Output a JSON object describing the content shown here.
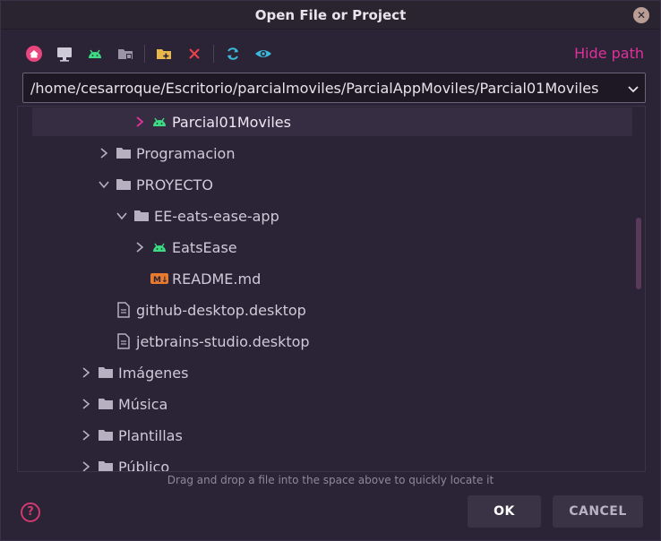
{
  "window": {
    "title": "Open File or Project"
  },
  "toolbar": {
    "icons": [
      "home-icon",
      "desktop-icon",
      "android-icon",
      "project-folder-icon",
      "new-folder-icon",
      "delete-icon",
      "refresh-icon",
      "show-hidden-icon"
    ],
    "hide_path_label": "Hide path"
  },
  "path": {
    "value": "/home/cesarroque/Escritorio/parcialmoviles/ParcialAppMoviles/Parcial01Moviles"
  },
  "tree": {
    "items": [
      {
        "label": "Parcial01Moviles",
        "icon": "android-icon",
        "expander": "collapsed",
        "selected": true
      },
      {
        "label": "Programacion",
        "icon": "folder-icon",
        "expander": "collapsed"
      },
      {
        "label": "PROYECTO",
        "icon": "folder-icon",
        "expander": "expanded"
      },
      {
        "label": "EE-eats-ease-app",
        "icon": "folder-icon",
        "expander": "expanded"
      },
      {
        "label": "EatsEase",
        "icon": "android-icon",
        "expander": "collapsed"
      },
      {
        "label": "README.md",
        "icon": "markdown-icon",
        "expander": "none"
      },
      {
        "label": "github-desktop.desktop",
        "icon": "file-icon",
        "expander": "none"
      },
      {
        "label": "jetbrains-studio.desktop",
        "icon": "file-icon",
        "expander": "none"
      },
      {
        "label": "Imágenes",
        "icon": "folder-icon",
        "expander": "collapsed"
      },
      {
        "label": "Música",
        "icon": "folder-icon",
        "expander": "collapsed"
      },
      {
        "label": "Plantillas",
        "icon": "folder-icon",
        "expander": "collapsed"
      },
      {
        "label": "Público",
        "icon": "folder-icon",
        "expander": "collapsed"
      }
    ]
  },
  "hint": "Drag and drop a file into the space above to quickly locate it",
  "buttons": {
    "ok": "OK",
    "cancel": "CANCEL"
  },
  "colors": {
    "accent": "#e0309a",
    "android_green": "#3ddc84",
    "folder": "#b6b0c0"
  }
}
